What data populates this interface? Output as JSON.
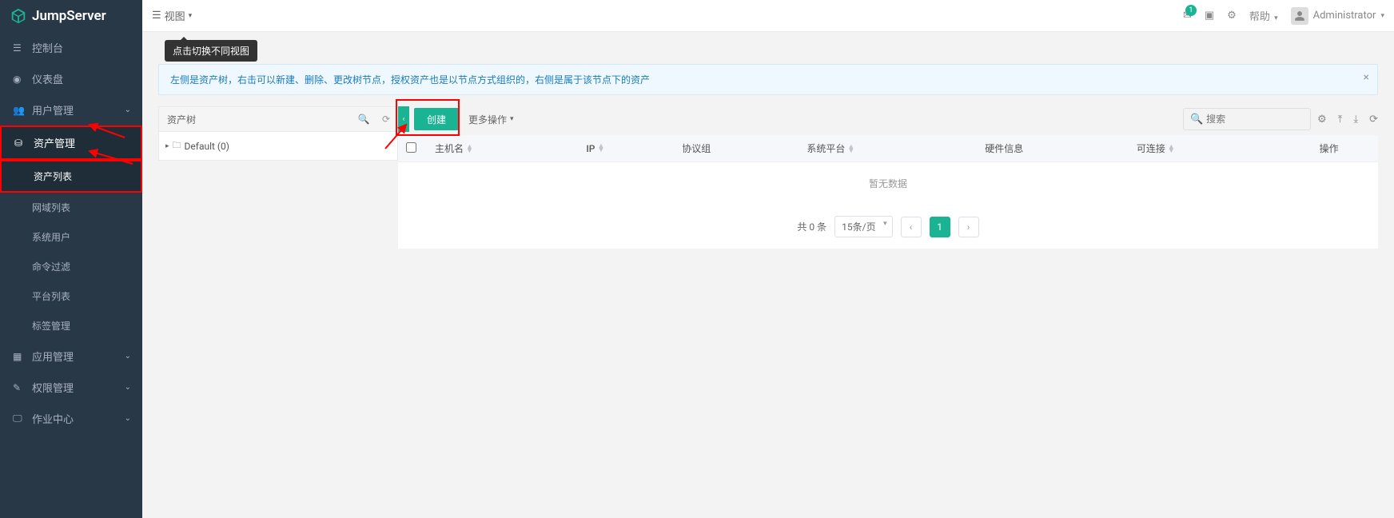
{
  "brand": "JumpServer",
  "header": {
    "view_label": "视图",
    "tooltip": "点击切换不同视图",
    "help_label": "帮助",
    "badge_count": "1",
    "user_name": "Administrator"
  },
  "sidebar": {
    "console": "控制台",
    "dashboard": "仪表盘",
    "user_mgmt": "用户管理",
    "asset_mgmt": "资产管理",
    "asset_list": "资产列表",
    "domain_list": "网域列表",
    "system_user": "系统用户",
    "cmd_filter": "命令过滤",
    "platform_list": "平台列表",
    "label_mgmt": "标签管理",
    "app_mgmt": "应用管理",
    "perm_mgmt": "权限管理",
    "ops_center": "作业中心"
  },
  "info_text": "左侧是资产树，右击可以新建、删除、更改树节点，授权资产也是以节点方式组织的，右侧是属于该节点下的资产",
  "tree": {
    "title": "资产树",
    "root_node": "Default (0)"
  },
  "actions": {
    "create": "创建",
    "more_ops": "更多操作"
  },
  "search": {
    "placeholder": "搜索"
  },
  "table": {
    "cols": {
      "hostname": "主机名",
      "ip": "IP",
      "protocol": "协议组",
      "platform": "系统平台",
      "hardware": "硬件信息",
      "connectable": "可连接",
      "ops": "操作"
    },
    "empty": "暂无数据"
  },
  "pagination": {
    "total_label": "共 0 条",
    "page_size": "15条/页",
    "current": "1"
  }
}
